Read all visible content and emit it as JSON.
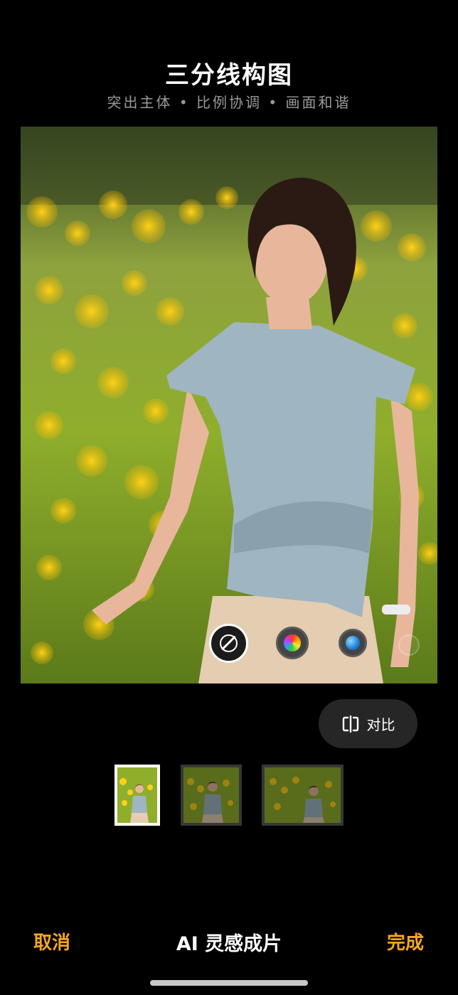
{
  "header": {
    "title": "三分线构图",
    "subtitle": "突出主体 • 比例协调 • 画面和谐"
  },
  "filters": {
    "icons": [
      "no-filter-icon",
      "multicolor-filter-icon",
      "blue-filter-icon",
      "faded-filter-icon"
    ],
    "selected": "no-filter-icon"
  },
  "compare": {
    "label": "对比",
    "icon": "compare-split-icon"
  },
  "thumbnails": {
    "count": 3,
    "selected_index": 0
  },
  "footer": {
    "cancel_label": "取消",
    "title": "AI 灵感成片",
    "done_label": "完成"
  },
  "colors": {
    "accent": "#f5a623",
    "background": "#000000",
    "subtitle": "#9a9a9a",
    "compare_bg": "#262626"
  }
}
